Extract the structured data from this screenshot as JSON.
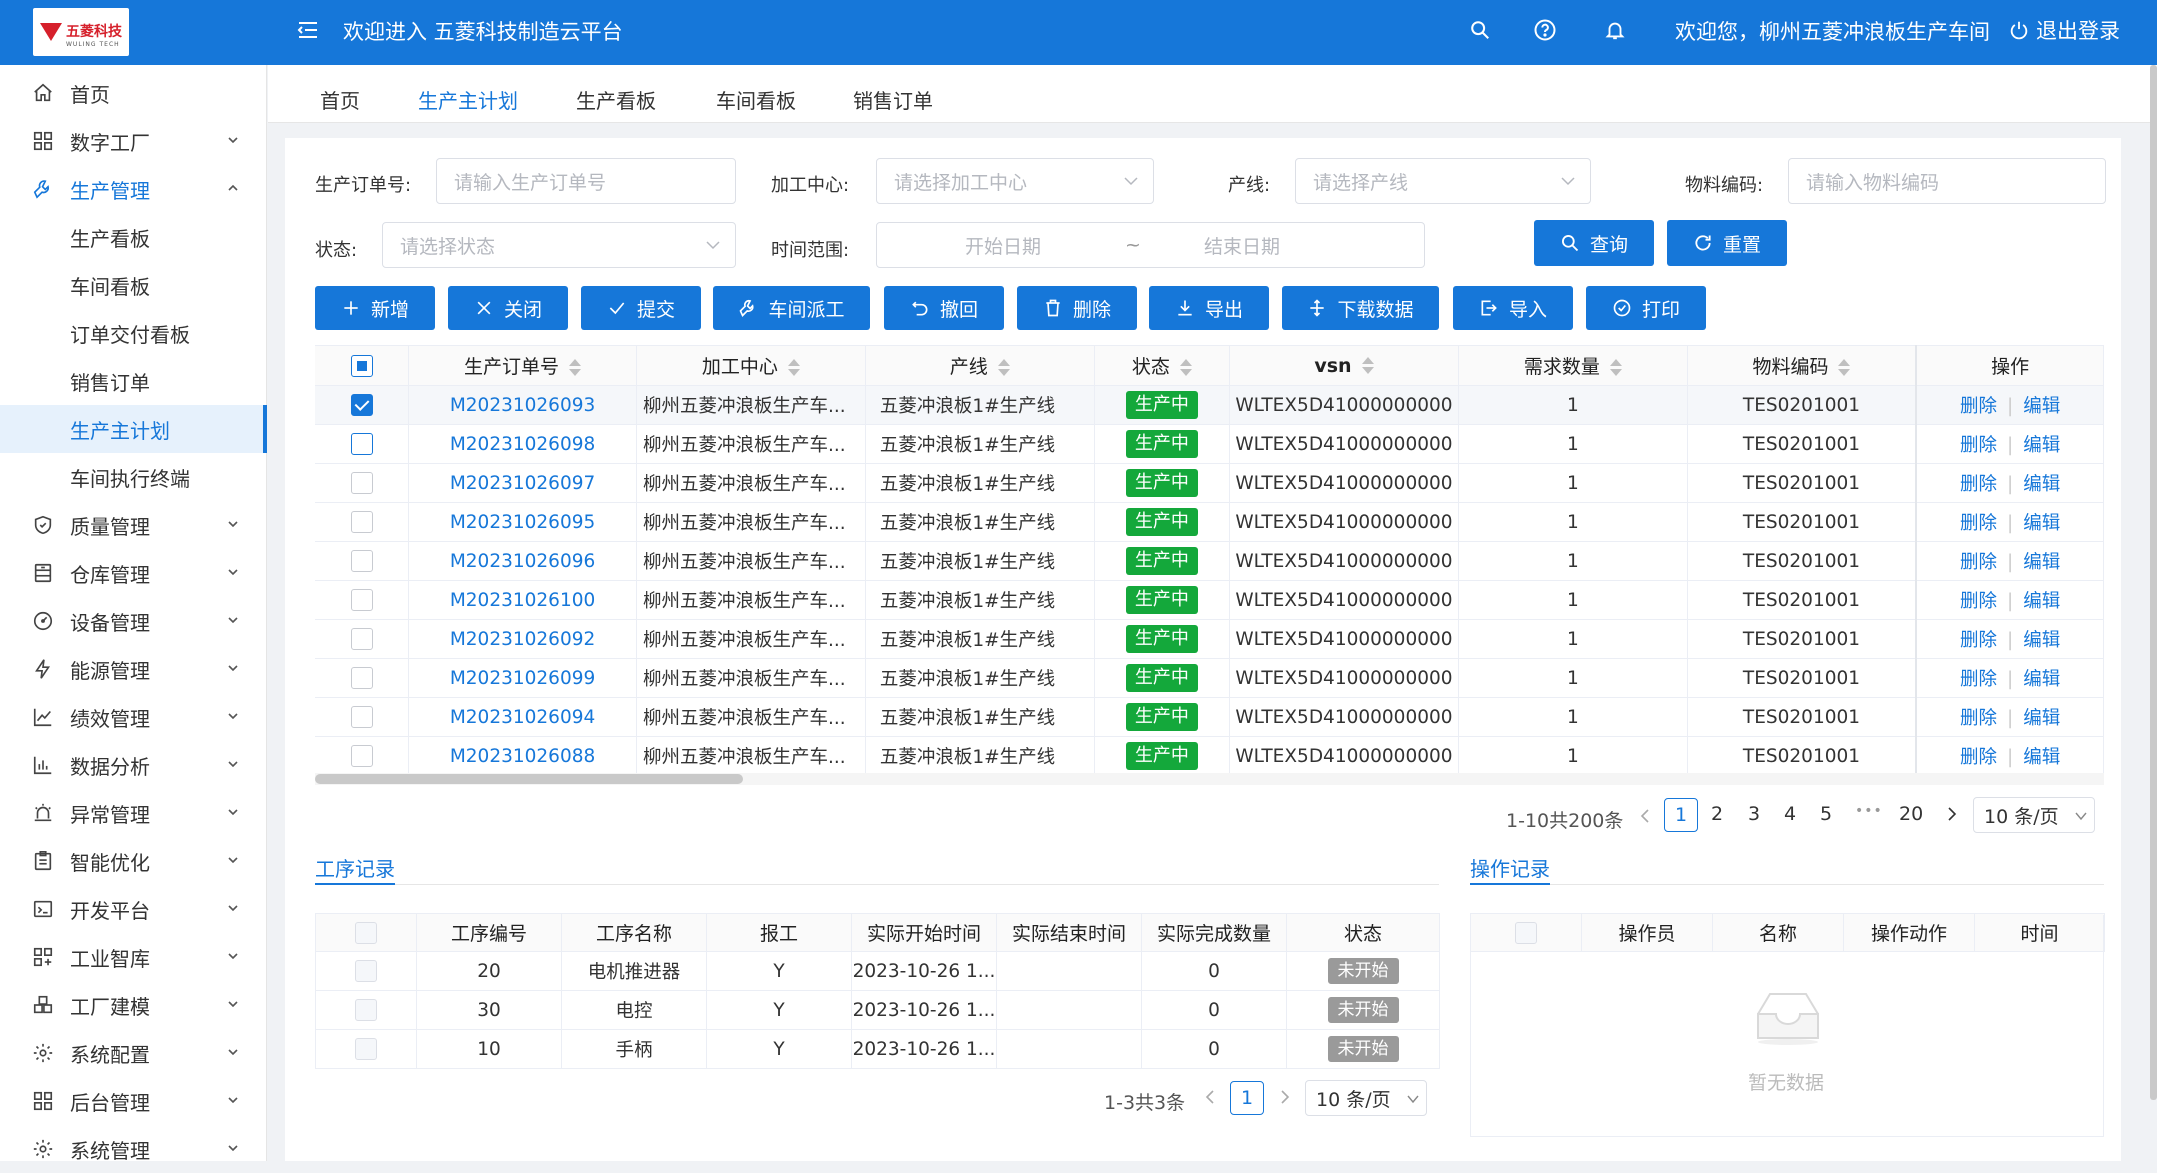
{
  "header": {
    "logo_text": "五菱科技",
    "logo_sub": "WULING TECH",
    "welcome": "欢迎进入 五菱科技制造云平台",
    "user_greeting": "欢迎您，柳州五菱冲浪板生产车间",
    "logout": "退出登录"
  },
  "sidebar": {
    "items": [
      {
        "label": "首页",
        "icon": "home-icon"
      },
      {
        "label": "数字工厂",
        "icon": "grid-icon"
      },
      {
        "label": "生产管理",
        "icon": "wrench-icon"
      },
      {
        "label": "质量管理",
        "icon": "shield-icon"
      },
      {
        "label": "仓库管理",
        "icon": "warehouse-icon"
      },
      {
        "label": "设备管理",
        "icon": "gauge-icon"
      },
      {
        "label": "能源管理",
        "icon": "bolt-icon"
      },
      {
        "label": "绩效管理",
        "icon": "line-chart-icon"
      },
      {
        "label": "数据分析",
        "icon": "bar-chart-icon"
      },
      {
        "label": "异常管理",
        "icon": "alarm-icon"
      },
      {
        "label": "智能优化",
        "icon": "clipboard-icon"
      },
      {
        "label": "开发平台",
        "icon": "terminal-icon"
      },
      {
        "label": "工业智库",
        "icon": "apps-icon"
      },
      {
        "label": "工厂建模",
        "icon": "blocks-icon"
      },
      {
        "label": "系统配置",
        "icon": "cog-icon"
      },
      {
        "label": "后台管理",
        "icon": "grid-icon"
      },
      {
        "label": "系统管理",
        "icon": "cog-icon"
      }
    ],
    "sub_items": [
      "生产看板",
      "车间看板",
      "订单交付看板",
      "销售订单",
      "生产主计划",
      "车间执行终端"
    ]
  },
  "tabs": [
    "首页",
    "生产主计划",
    "生产看板",
    "车间看板",
    "销售订单"
  ],
  "filters": {
    "order_label": "生产订单号:",
    "order_placeholder": "请输入生产订单号",
    "center_label": "加工中心:",
    "center_placeholder": "请选择加工中心",
    "line_label": "产线:",
    "line_placeholder": "请选择产线",
    "material_label": "物料编码:",
    "material_placeholder": "请输入物料编码",
    "status_label": "状态:",
    "status_placeholder": "请选择状态",
    "time_label": "时间范围:",
    "start_placeholder": "开始日期",
    "range_sep": "~",
    "end_placeholder": "结束日期",
    "query": "查询",
    "reset": "重置"
  },
  "toolbar": [
    "新增",
    "关闭",
    "提交",
    "车间派工",
    "撤回",
    "删除",
    "导出",
    "下载数据",
    "导入",
    "打印"
  ],
  "table": {
    "columns": [
      "生产订单号",
      "加工中心",
      "产线",
      "状态",
      "vsn",
      "需求数量",
      "物料编码",
      "操作"
    ],
    "rows": [
      {
        "order": "M20231026093",
        "center": "柳州五菱冲浪板生产车...",
        "line": "五菱冲浪板1#生产线",
        "status": "生产中",
        "vsn": "WLTEX5D41000000000",
        "qty": "1",
        "material": "TES0201001"
      },
      {
        "order": "M20231026098",
        "center": "柳州五菱冲浪板生产车...",
        "line": "五菱冲浪板1#生产线",
        "status": "生产中",
        "vsn": "WLTEX5D41000000000",
        "qty": "1",
        "material": "TES0201001"
      },
      {
        "order": "M20231026097",
        "center": "柳州五菱冲浪板生产车...",
        "line": "五菱冲浪板1#生产线",
        "status": "生产中",
        "vsn": "WLTEX5D41000000000",
        "qty": "1",
        "material": "TES0201001"
      },
      {
        "order": "M20231026095",
        "center": "柳州五菱冲浪板生产车...",
        "line": "五菱冲浪板1#生产线",
        "status": "生产中",
        "vsn": "WLTEX5D41000000000",
        "qty": "1",
        "material": "TES0201001"
      },
      {
        "order": "M20231026096",
        "center": "柳州五菱冲浪板生产车...",
        "line": "五菱冲浪板1#生产线",
        "status": "生产中",
        "vsn": "WLTEX5D41000000000",
        "qty": "1",
        "material": "TES0201001"
      },
      {
        "order": "M20231026100",
        "center": "柳州五菱冲浪板生产车...",
        "line": "五菱冲浪板1#生产线",
        "status": "生产中",
        "vsn": "WLTEX5D41000000000",
        "qty": "1",
        "material": "TES0201001"
      },
      {
        "order": "M20231026092",
        "center": "柳州五菱冲浪板生产车...",
        "line": "五菱冲浪板1#生产线",
        "status": "生产中",
        "vsn": "WLTEX5D41000000000",
        "qty": "1",
        "material": "TES0201001"
      },
      {
        "order": "M20231026099",
        "center": "柳州五菱冲浪板生产车...",
        "line": "五菱冲浪板1#生产线",
        "status": "生产中",
        "vsn": "WLTEX5D41000000000",
        "qty": "1",
        "material": "TES0201001"
      },
      {
        "order": "M20231026094",
        "center": "柳州五菱冲浪板生产车...",
        "line": "五菱冲浪板1#生产线",
        "status": "生产中",
        "vsn": "WLTEX5D41000000000",
        "qty": "1",
        "material": "TES0201001"
      },
      {
        "order": "M20231026088",
        "center": "柳州五菱冲浪板生产车...",
        "line": "五菱冲浪板1#生产线",
        "status": "生产中",
        "vsn": "WLTEX5D41000000000",
        "qty": "1",
        "material": "TES0201001"
      }
    ],
    "action_delete": "删除",
    "action_edit": "编辑",
    "action_sep": "|"
  },
  "pagination": {
    "total": "1-10共200条",
    "pages": [
      "1",
      "2",
      "3",
      "4",
      "5"
    ],
    "ellipsis": "•••",
    "last": "20",
    "size": "10 条/页"
  },
  "process": {
    "title": "工序记录",
    "columns": [
      "工序编号",
      "工序名称",
      "报工",
      "实际开始时间",
      "实际结束时间",
      "实际完成数量",
      "状态"
    ],
    "rows": [
      {
        "no": "20",
        "name": "电机推进器",
        "report": "Y",
        "start": "2023-10-26 1...",
        "end": "",
        "done": "0",
        "status": "未开始"
      },
      {
        "no": "30",
        "name": "电控",
        "report": "Y",
        "start": "2023-10-26 1...",
        "end": "",
        "done": "0",
        "status": "未开始"
      },
      {
        "no": "10",
        "name": "手柄",
        "report": "Y",
        "start": "2023-10-26 1...",
        "end": "",
        "done": "0",
        "status": "未开始"
      }
    ],
    "total": "1-3共3条",
    "page": "1",
    "size": "10 条/页"
  },
  "operation": {
    "title": "操作记录",
    "columns": [
      "操作员",
      "名称",
      "操作动作",
      "时间"
    ],
    "empty": "暂无数据"
  },
  "colors": {
    "primary": "#1677d9",
    "running": "#14a83b",
    "idle": "#9a9a9a"
  }
}
